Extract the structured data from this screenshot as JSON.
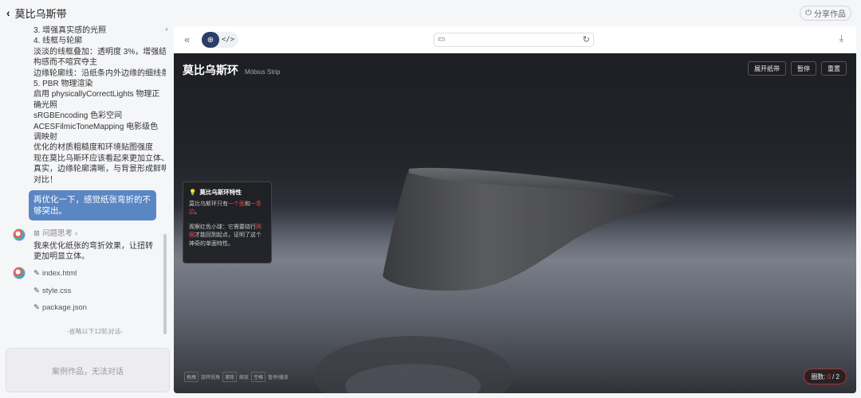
{
  "header": {
    "back_label": "莫比乌斯带",
    "share_label": "分享作品"
  },
  "chat": {
    "ai_lines": [
      "3. 增强真实感的光照",
      "4. 线框与轮廓",
      "淡淡的线框叠加：透明度 3%，增强结",
      "构感而不喧宾夺主",
      "边缘轮廓线：沿纸条内外边缘的细线条",
      "5. PBR 物理渲染",
      "启用 physicallyCorrectLights 物理正",
      "确光照",
      "sRGBEncoding 色彩空间",
      "ACESFilmicToneMapping 电影级色",
      "调映射",
      "优化的材质粗糙度和环境贴图强度",
      "现在莫比乌斯环应该看起来更加立体、",
      "真实，边缘轮廓清晰，与背景形成鲜明",
      "对比！"
    ],
    "user_message": "再优化一下，感觉纸张弯折的不够突出。",
    "think_label": "问题思考",
    "reply_text": "我来优化纸张的弯折效果，让扭转更加明显立体。",
    "files": [
      "index.html",
      "style.css",
      "package.json"
    ],
    "omitted_note": "-省略以下12轮对话-",
    "case_note": "案例作品，无法对话"
  },
  "preview": {
    "title": "莫比乌斯环",
    "subtitle": "Möbius Strip",
    "buttons": [
      "展开纸带",
      "暂停",
      "重置"
    ],
    "info_title": "莫比乌斯环特性",
    "info_p1_a": "莫比乌斯环只有",
    "info_p1_b": "一个面",
    "info_p1_c": "和",
    "info_p1_d": "一条边",
    "info_p1_e": "。",
    "info_p2_a": "观察红色小球：它需要绕行",
    "info_p2_b": "两圈",
    "info_p2_c": "才能回到起点，证明了这个神奇的单面特性。",
    "hints": [
      {
        "key": "拖拽",
        "text": "旋转视角"
      },
      {
        "key": "滚轮",
        "text": "缩放"
      },
      {
        "key": "空格",
        "text": "暂停/播放"
      }
    ],
    "counter_label": "圈数:",
    "counter_current": "0",
    "counter_total": "/ 2"
  },
  "colors": {
    "accent": "#2c3e66",
    "user_bubble": "#5a86c4",
    "highlight": "#e04848"
  }
}
